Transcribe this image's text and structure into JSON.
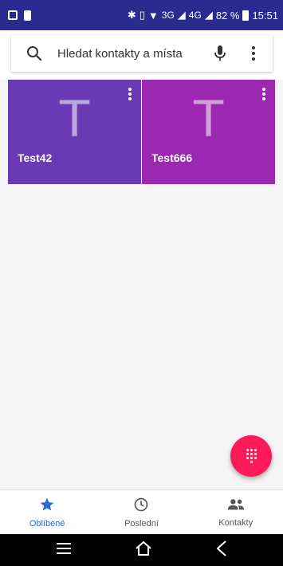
{
  "status_bar": {
    "network_text": "3G",
    "network2_text": "4G",
    "battery_text": "82 %",
    "time": "15:51"
  },
  "search": {
    "placeholder": "Hledat kontakty a místa"
  },
  "favorites": [
    {
      "initial": "T",
      "name": "Test42",
      "color": "#6a3ab5"
    },
    {
      "initial": "T",
      "name": "Test666",
      "color": "#9c27b0"
    }
  ],
  "bottom_nav": {
    "tabs": [
      {
        "label": "Oblíbené",
        "icon": "star-icon",
        "active": true
      },
      {
        "label": "Poslední",
        "icon": "clock-icon",
        "active": false
      },
      {
        "label": "Kontakty",
        "icon": "people-icon",
        "active": false
      }
    ]
  },
  "colors": {
    "status_bar": "#2a2a8f",
    "accent": "#2c6bd6",
    "fab": "#ff1a5a"
  }
}
